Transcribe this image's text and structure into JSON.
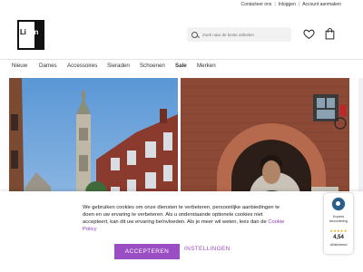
{
  "utility_links": [
    "Contacteer ons",
    "Inloggen",
    "Account aanmaken"
  ],
  "logo": {
    "text_dark": "Li",
    "text_light": "en"
  },
  "search": {
    "placeholder": "Zoek naar de beste artikelen"
  },
  "icons": {
    "heart": "heart-icon",
    "bag": "shopping-bag-icon",
    "search": "search-icon"
  },
  "nav": [
    "Nieuw",
    "Dames",
    "Accessoires",
    "Sieraden",
    "Schoenen",
    "Sale",
    "Merken"
  ],
  "cookie": {
    "text": "We gebruiken cookies om onze diensten te verbeteren, persoonlijke aanbiedingen te doen en uw ervaring te verbeteren. Als u onderstaande optionele cookies niet accepteert, kan dit uw ervaring beïnvloeden. Als je meer wil weten, lees dan de",
    "policy_link": "Cookie Policy",
    "accept": "ACCEPTEREN",
    "settings": "INSTELLINGEN"
  },
  "badge": {
    "label_top": "Kopers",
    "label_bottom": "beoordeling",
    "stars": "★★★★★",
    "score": "4,54",
    "rating_word": "Uitstekend"
  },
  "colors": {
    "accent": "#9b4dc3",
    "badge_star": "#e6a300"
  }
}
